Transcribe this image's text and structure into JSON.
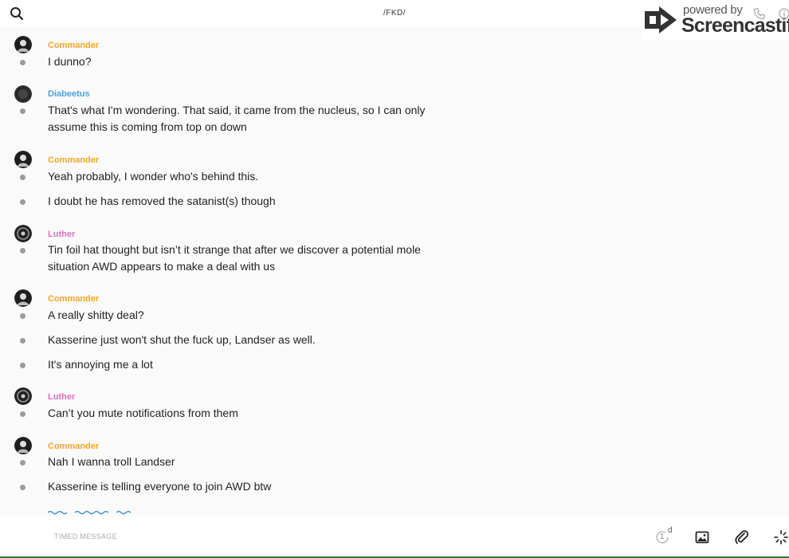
{
  "header": {
    "channel": "/FKD/"
  },
  "watermark": {
    "powered_by": "powered by",
    "brand": "Screencastify"
  },
  "colors": {
    "commander": "#f5a623",
    "diabeetus": "#4aa3df",
    "luther": "#e070c0"
  },
  "messages": [
    {
      "author": "Commander",
      "color": "commander",
      "lines": [
        "I dunno?"
      ]
    },
    {
      "author": "Diabeetus",
      "color": "diabeetus",
      "lines": [
        "That's what I'm wondering. That said, it came from the nucleus, so I can only assume this is coming from top on down"
      ]
    },
    {
      "author": "Commander",
      "color": "commander",
      "lines": [
        "Yeah probably, I wonder who's behind this.",
        "I doubt he has removed the satanist(s) though"
      ]
    },
    {
      "author": "Luther",
      "color": "luther",
      "lines": [
        "Tin foil hat thought but isn’t it strange that after we discover a potential mole situation AWD appears to make a deal with us"
      ]
    },
    {
      "author": "Commander",
      "color": "commander",
      "lines": [
        "A really shitty deal?",
        "Kasserine just won't shut the fuck up, Landser as well.",
        "It's annoying me a lot"
      ]
    },
    {
      "author": "Luther",
      "color": "luther",
      "lines": [
        "Can’t you mute notifications from them"
      ]
    },
    {
      "author": "Commander",
      "color": "commander",
      "lines": [
        "Nah I wanna troll Landser",
        "Kasserine is telling everyone to join AWD btw"
      ]
    }
  ],
  "composer": {
    "placeholder": "TIMED MESSAGE",
    "timer_value": "1",
    "timer_unit": "d"
  }
}
